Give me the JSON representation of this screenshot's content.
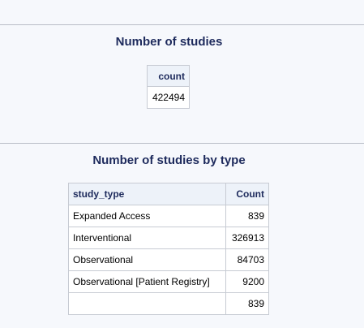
{
  "section1": {
    "title": "Number of studies",
    "header": "count",
    "value": "422494"
  },
  "section2": {
    "title": "Number of studies by type",
    "headers": [
      "study_type",
      "Count"
    ],
    "rows": [
      {
        "study_type": "Expanded Access",
        "count": "839"
      },
      {
        "study_type": "Interventional",
        "count": "326913"
      },
      {
        "study_type": "Observational",
        "count": "84703"
      },
      {
        "study_type": "Observational [Patient Registry]",
        "count": "9200"
      },
      {
        "study_type": "",
        "count": "839"
      }
    ]
  },
  "colors": {
    "background": "#f6f8fc",
    "title": "#1d2a5c",
    "header_bg": "#edf2f9",
    "border": "#c7cbd3"
  }
}
